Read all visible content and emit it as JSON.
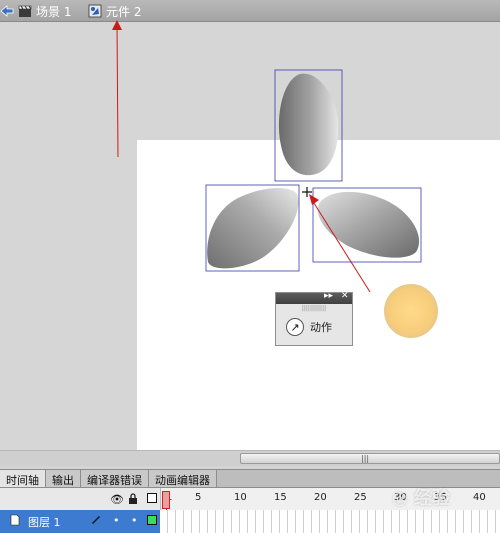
{
  "breadcrumb": {
    "items": [
      {
        "label": "场景 1",
        "icon": "clapperboard-icon"
      },
      {
        "label": "元件 2",
        "icon": "graphic-symbol-icon"
      }
    ]
  },
  "panel": {
    "action_label": "动作",
    "controls": [
      "▸▸",
      "✕"
    ]
  },
  "timeline": {
    "tabs": [
      "时间轴",
      "输出",
      "编译器错误",
      "动画编辑器"
    ],
    "active_tab": "时间轴",
    "ruler_labels": [
      "1",
      "5",
      "10",
      "15",
      "20",
      "25",
      "30",
      "35",
      "40"
    ],
    "layer_name": "图层 1",
    "current_frame": "1"
  },
  "scrollbar": {
    "grip": "|||"
  },
  "colors": {
    "stage": "#ffffff",
    "pasteboard": "#d6d6d6",
    "layer_highlight": "#3d7bd0",
    "annotation_arrow": "#cc1a1a",
    "circle_fill": "#f7cd7a"
  }
}
